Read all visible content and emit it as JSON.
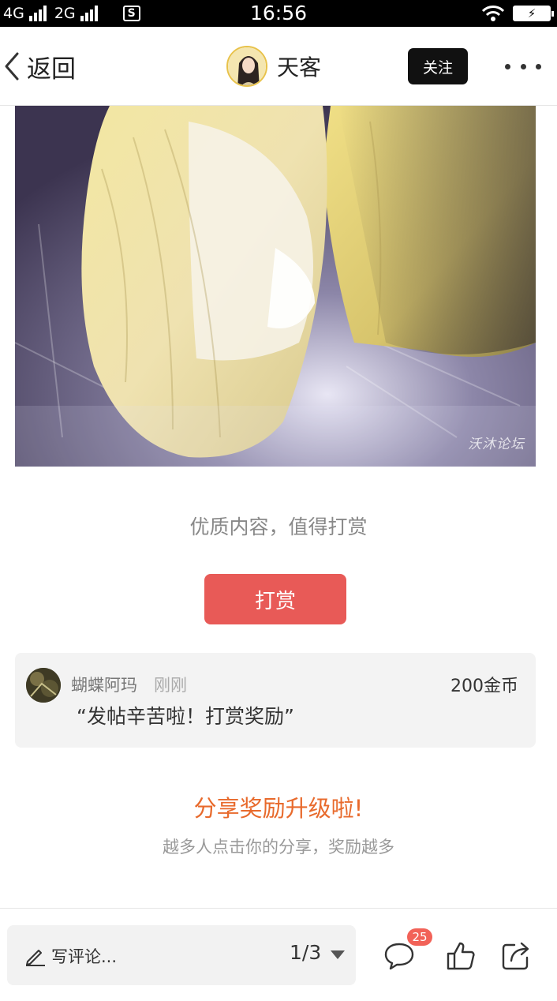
{
  "status_bar": {
    "network1": "4G",
    "network2": "2G",
    "time": "16:56",
    "battery_icon": "charging-battery-icon"
  },
  "nav": {
    "back_label": "返回",
    "author_name": "天客",
    "follow_label": "关注"
  },
  "post": {
    "watermark": "沃沐论坛"
  },
  "tip": {
    "prompt": "优质内容，值得打赏",
    "button_label": "打赏",
    "record": {
      "user": "蝴蝶阿玛",
      "time": "刚刚",
      "amount": "200金币",
      "message": "“发帖辛苦啦！打赏奖励”"
    }
  },
  "share": {
    "title": "分享奖励升级啦!",
    "subtitle": "越多人点击你的分享，奖励越多"
  },
  "bottom_bar": {
    "comment_placeholder": "写评论...",
    "page_indicator": "1/3",
    "comment_count": "25",
    "icons": [
      "pencil-icon",
      "chevron-down-icon",
      "comment-icon",
      "thumbs-up-icon",
      "share-icon"
    ]
  },
  "colors": {
    "tip_button": "#e85a57",
    "share_title": "#e86a2c",
    "badge": "#f26258"
  }
}
